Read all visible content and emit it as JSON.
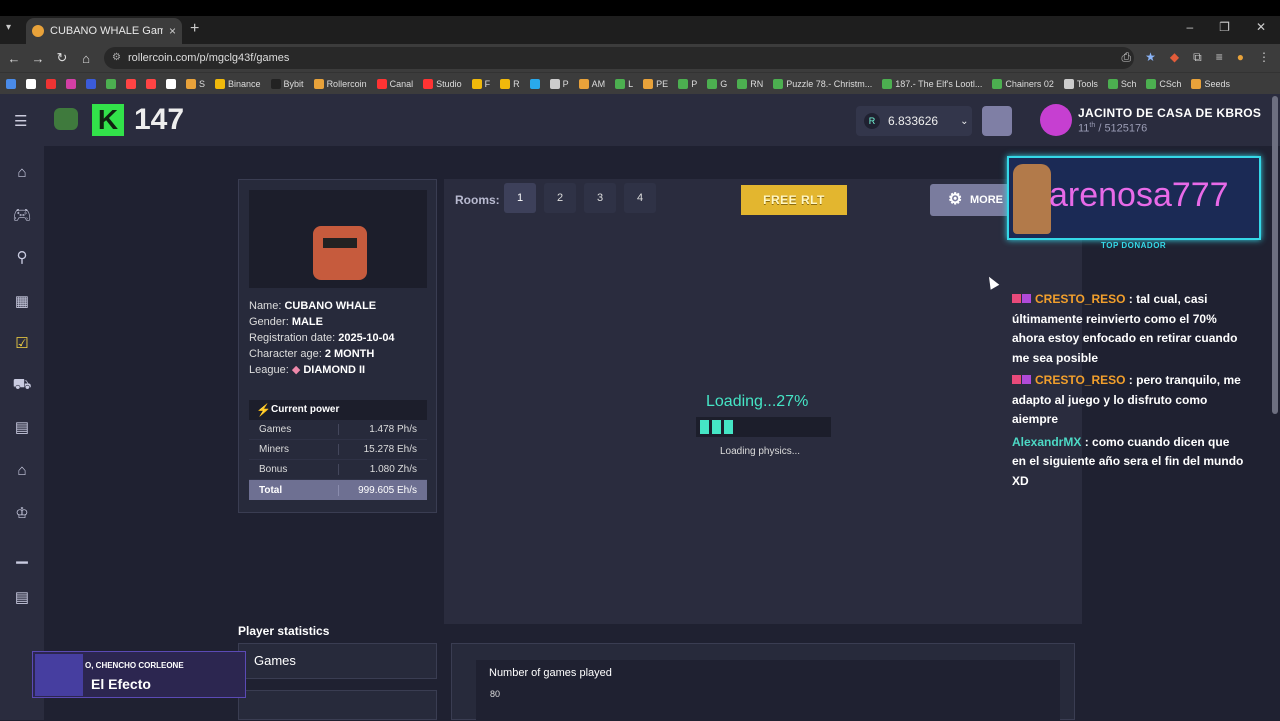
{
  "browser": {
    "tab_title": "CUBANO WHALE Games | Rolle",
    "url": "rollercoin.com/p/mgclg43f/games",
    "bookmarks": [
      "S",
      "Binance",
      "Bybit",
      "Rollercoin",
      "Canal",
      "Studio",
      "F",
      "R",
      "P",
      "AM",
      "L",
      "PE",
      "P",
      "G",
      "RN",
      "Puzzle 78.- Christm...",
      "187.- The Elf's Lootl...",
      "Chainers 02",
      "Tools",
      "Sch",
      "CSch",
      "Seeds"
    ]
  },
  "header": {
    "k_logo": "K",
    "k_count": "147",
    "balance": "6.833626",
    "currency_symbol": "R",
    "user_name": "JACINTO DE CASA DE KBROS",
    "user_rank": "11",
    "user_rank_suffix": "th",
    "user_total": "/ 5125176"
  },
  "profile": {
    "name_label": "Name:",
    "name": "CUBANO WHALE",
    "gender_label": "Gender:",
    "gender": "MALE",
    "reg_label": "Registration date:",
    "reg_date": "2025-10-04",
    "age_label": "Character age:",
    "age": "2 MONTH",
    "league_label": "League:",
    "league": "DIAMOND II",
    "power_title": "Current power",
    "power_rows": [
      {
        "k": "Games",
        "v": "1.478 Ph/s"
      },
      {
        "k": "Miners",
        "v": "15.278 Eh/s"
      },
      {
        "k": "Bonus",
        "v": "1.080 Zh/s"
      }
    ],
    "total_label": "Total",
    "total_value": "999.605 Eh/s"
  },
  "game": {
    "rooms_label": "Rooms:",
    "rooms": [
      "1",
      "2",
      "3",
      "4"
    ],
    "free_rlt": "FREE RLT",
    "more": "MORE",
    "loading": "Loading...27%",
    "loading_progress": 0.27,
    "loading_sub": "Loading physics..."
  },
  "stats": {
    "title": "Player statistics",
    "games_tab": "Games",
    "chart_title": "Number of games played",
    "chart_y_top": "80"
  },
  "overlay": {
    "donor_name": "arenosa777",
    "donor_label": "TOP DONADOR",
    "chat": [
      {
        "user": "CRESTO_RESO",
        "text": " : tal cual, casi últimamente reinvierto como el 70% ahora estoy enfocado en retirar cuando me sea posible"
      },
      {
        "user": "CRESTO_RESO",
        "text": " : pero tranquilo, me adapto al juego y lo disfruto como aiempre"
      },
      {
        "user": "AlexandrMX",
        "text": " : como cuando dicen que en el siguiente año sera el fin del mundo XD"
      }
    ],
    "efecto_top": "O, CHENCHO CORLEONE",
    "efecto_main": "El Efecto"
  },
  "colors": {
    "accent_teal": "#45e5c5",
    "gold": "#e3b62f",
    "donor_pink": "#e86ae8"
  }
}
